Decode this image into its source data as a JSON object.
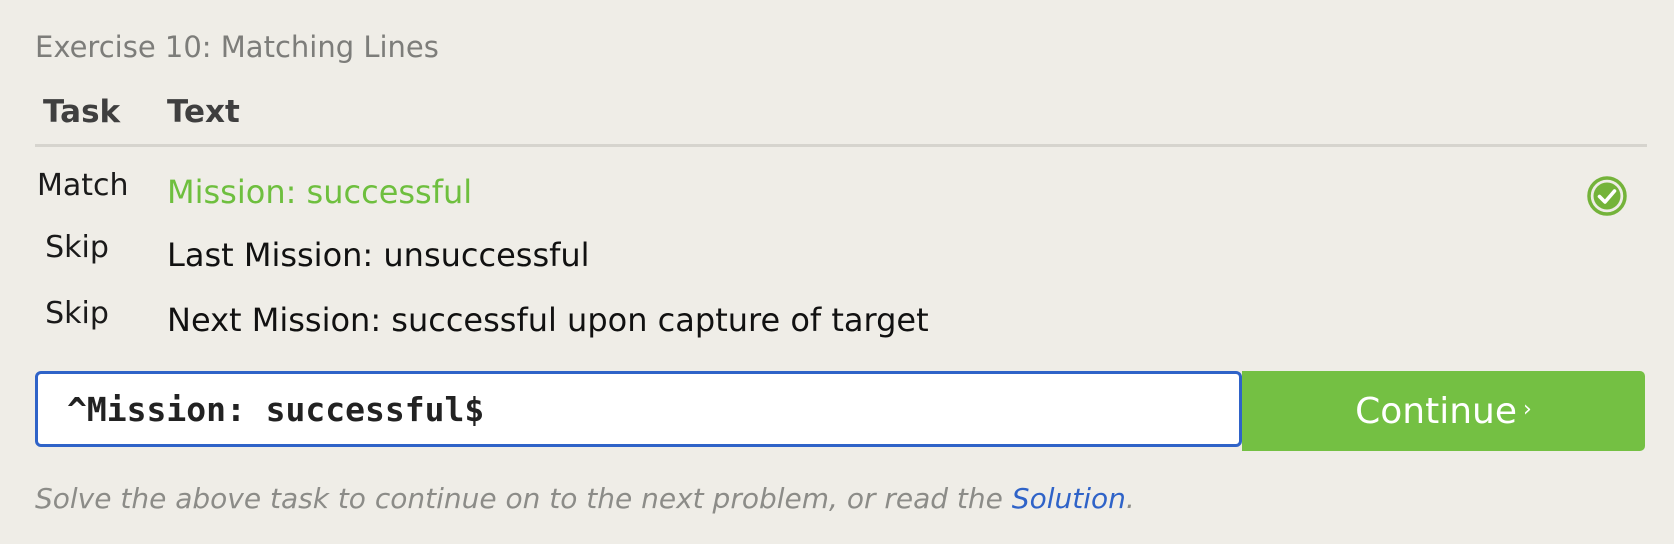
{
  "exercise": {
    "title": "Exercise 10: Matching Lines"
  },
  "table": {
    "headers": {
      "task": "Task",
      "text": "Text"
    },
    "rows": [
      {
        "task": "Match",
        "text": "Mission: successful",
        "status": "solved",
        "status_icon": "check-circle-icon"
      },
      {
        "task": "Skip",
        "text": "Last Mission: unsuccessful"
      },
      {
        "task": "Skip",
        "text": "Next Mission: successful upon capture of target"
      }
    ]
  },
  "answer": {
    "value": "^Mission: successful$"
  },
  "continue_button": {
    "label": "Continue",
    "arrow": "›"
  },
  "footer": {
    "text_before": "Solve the above task to continue on to the next problem, or read the ",
    "link": "Solution",
    "text_after": "."
  },
  "colors": {
    "background": "#efede7",
    "matched_text": "#6ebf3e",
    "accent_blue": "#2f63c8",
    "continue_green": "#74c043",
    "check_icon": "#74b33a"
  }
}
